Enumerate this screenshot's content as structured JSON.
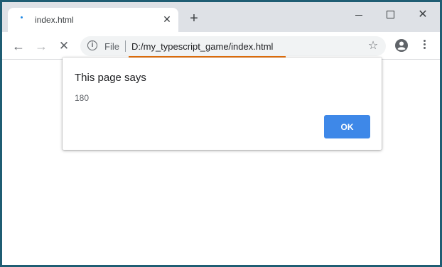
{
  "browser": {
    "tab": {
      "title": "index.html",
      "close_glyph": "✕"
    },
    "new_tab_glyph": "+",
    "window_controls": {
      "close_glyph": "✕"
    },
    "omnibox": {
      "scheme_label": "File",
      "url": "D:/my_typescript_game/index.html",
      "underline_color": "#e8710a"
    },
    "nav": {
      "back_glyph": "←",
      "forward_glyph": "→",
      "stop_glyph": "✕"
    },
    "star_glyph": "☆",
    "info_glyph": "i"
  },
  "dialog": {
    "title": "This page says",
    "message": "180",
    "ok_label": "OK",
    "ok_color": "#3e88e8"
  },
  "icons": [
    "favicon-icon",
    "close-icon",
    "plus-icon",
    "minimize-icon",
    "maximize-icon",
    "back-icon",
    "forward-icon",
    "stop-icon",
    "info-icon",
    "star-icon",
    "account-icon",
    "menu-icon"
  ]
}
